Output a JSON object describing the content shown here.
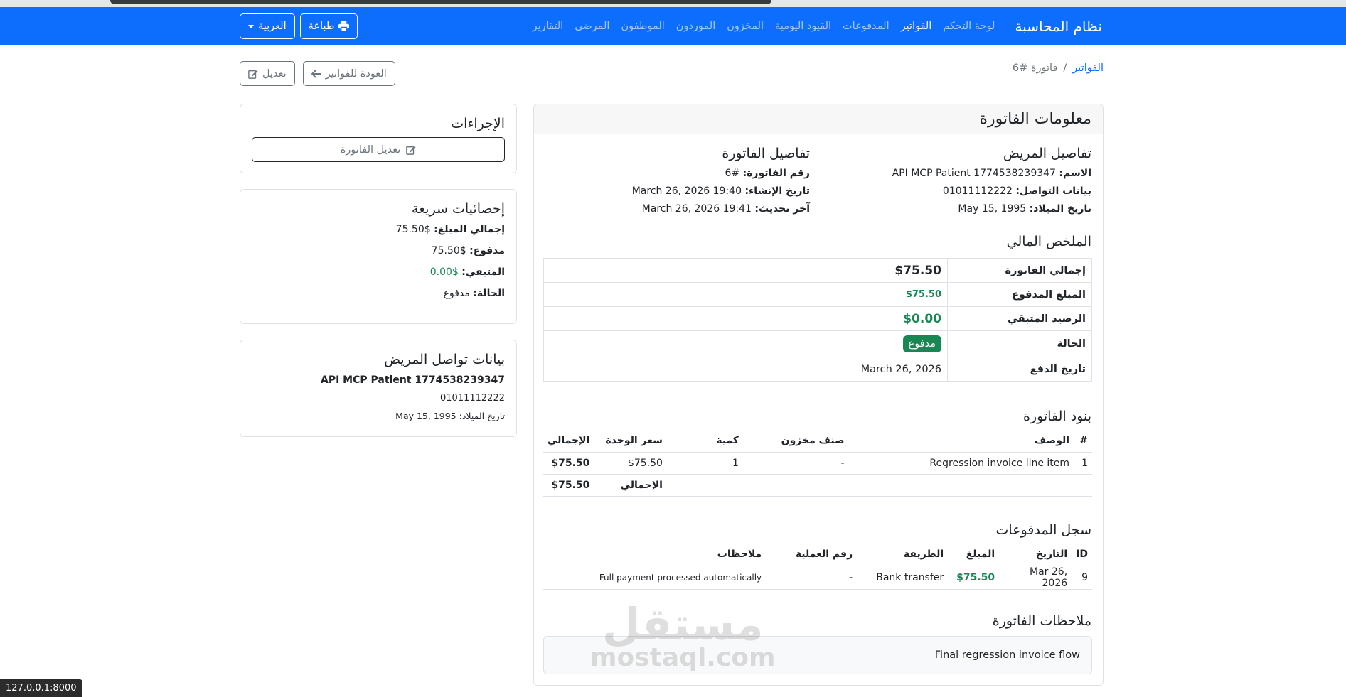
{
  "browser": {
    "status_url": "127.0.0.1:8000"
  },
  "navbar": {
    "brand": "نظام المحاسبة",
    "links": [
      "لوحة التحكم",
      "الفواتير",
      "المدفوعات",
      "القيود اليومية",
      "المخزون",
      "الموردون",
      "الموظفون",
      "المرضى",
      "التقارير"
    ],
    "print_label": "طباعة",
    "language_label": "العربية"
  },
  "breadcrumb": {
    "parent": "الفواتير",
    "separator": "/",
    "current": "فاتورة #6"
  },
  "top_buttons": {
    "back_label": "العودة للفواتير",
    "edit_label": "تعديل"
  },
  "invoice": {
    "header": "معلومات الفاتورة",
    "patient": {
      "title": "تفاصيل المريض",
      "name_label": "الاسم:",
      "name": "API MCP Patient 1774538239347",
      "contact_label": "بيانات التواصل:",
      "contact": "01011112222",
      "dob_label": "تاريخ الميلاد:",
      "dob": "May 15, 1995"
    },
    "details": {
      "title": "تفاصيل الفاتورة",
      "number_label": "رقم الفاتورة:",
      "number": "#6",
      "created_label": "تاريخ الإنشاء:",
      "created": "March 26, 2026 19:40",
      "updated_label": "آخر تحديث:",
      "updated": "March 26, 2026 19:41"
    },
    "financial": {
      "title": "الملخص المالي",
      "total_label": "إجمالي الفاتورة",
      "total": "$75.50",
      "paid_label": "المبلغ المدفوع",
      "paid": "$75.50",
      "remaining_label": "الرصيد المتبقي",
      "remaining": "$0.00",
      "status_label": "الحالة",
      "status": "مدفوع",
      "pay_date_label": "تاريخ الدفع",
      "pay_date": "March 26, 2026"
    },
    "items": {
      "title": "بنود الفاتورة",
      "headers": {
        "num": "#",
        "desc": "الوصف",
        "stock": "صنف مخزون",
        "qty": "كمية",
        "unit_price": "سعر الوحدة",
        "total": "الإجمالي"
      },
      "rows": [
        {
          "num": "1",
          "desc": "Regression invoice line item",
          "stock": "-",
          "qty": "1",
          "unit_price": "$75.50",
          "total": "$75.50"
        }
      ],
      "footer_label": "الإجمالي",
      "footer_total": "$75.50"
    },
    "payments": {
      "title": "سجل المدفوعات",
      "headers": {
        "id": "ID",
        "date": "التاريخ",
        "amount": "المبلغ",
        "method": "الطريقة",
        "txn": "رقم العملية",
        "notes": "ملاحظات"
      },
      "rows": [
        {
          "id": "9",
          "date": "Mar 26, 2026",
          "amount": "$75.50",
          "method": "Bank transfer",
          "txn": "-",
          "notes": "Full payment processed automatically"
        }
      ]
    },
    "notes": {
      "title": "ملاحظات الفاتورة",
      "text": "Final regression invoice flow"
    }
  },
  "actions": {
    "title": "الإجراءات",
    "edit_invoice_label": "تعديل الفاتورة"
  },
  "quick_stats": {
    "title": "إحصائيات سريعة",
    "total_label": "إجمالي المبلغ:",
    "total": "$75.50",
    "paid_label": "مدفوع:",
    "paid": "$75.50",
    "remaining_label": "المتبقي:",
    "remaining": "$0.00",
    "status_label": "الحالة:",
    "status": "مدفوع"
  },
  "patient_contact": {
    "title": "بيانات تواصل المريض",
    "name": "API MCP Patient 1774538239347",
    "phone": "01011112222",
    "dob_label": "تاريخ الميلاد:",
    "dob": "May 15, 1995"
  },
  "watermark": {
    "ar": "مستقل",
    "en": "mostaql.com"
  },
  "colors": {
    "primary": "#0d6efd",
    "success": "#198754",
    "secondary": "#6c757d"
  }
}
